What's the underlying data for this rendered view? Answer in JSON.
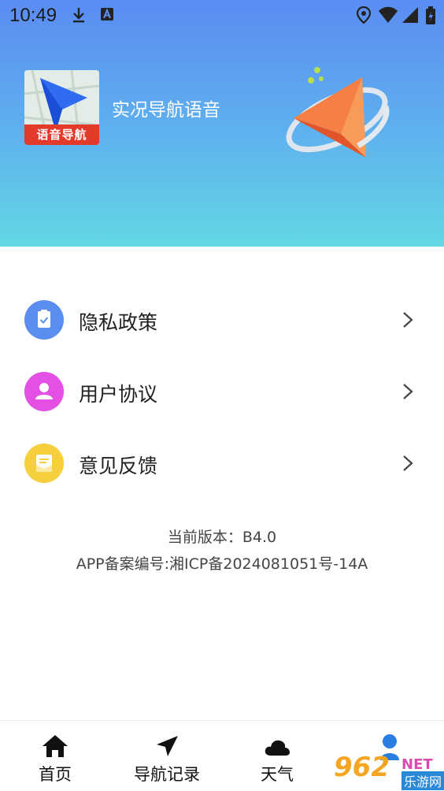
{
  "status_bar": {
    "time": "10:49",
    "icons": [
      "download-icon",
      "a-notification-icon",
      "location-icon",
      "wifi-icon",
      "signal-icon",
      "battery-icon"
    ]
  },
  "header": {
    "app_title": "实况导航语音",
    "logo_badge": "语音导航"
  },
  "menu": {
    "items": [
      {
        "label": "隐私政策",
        "icon": "clipboard-check-icon",
        "color": "#5b8cf0"
      },
      {
        "label": "用户协议",
        "icon": "user-icon",
        "color": "#e350e3"
      },
      {
        "label": "意见反馈",
        "icon": "mail-icon",
        "color": "#f6cf3c"
      }
    ]
  },
  "version": {
    "version_line": "当前版本：B4.0",
    "record_line": "APP备案编号:湘ICP备2024081051号-14A"
  },
  "bottom_nav": {
    "items": [
      {
        "label": "首页",
        "icon": "home-icon"
      },
      {
        "label": "导航记录",
        "icon": "navigation-arrow-icon"
      },
      {
        "label": "天气",
        "icon": "cloud-icon"
      }
    ]
  },
  "watermark": {
    "brand": "962",
    "net": "NET",
    "sub": "乐游网"
  },
  "colors": {
    "header_top": "#5a8cf2",
    "header_bottom": "#62d8e4",
    "accent_blue": "#2a7de1"
  }
}
